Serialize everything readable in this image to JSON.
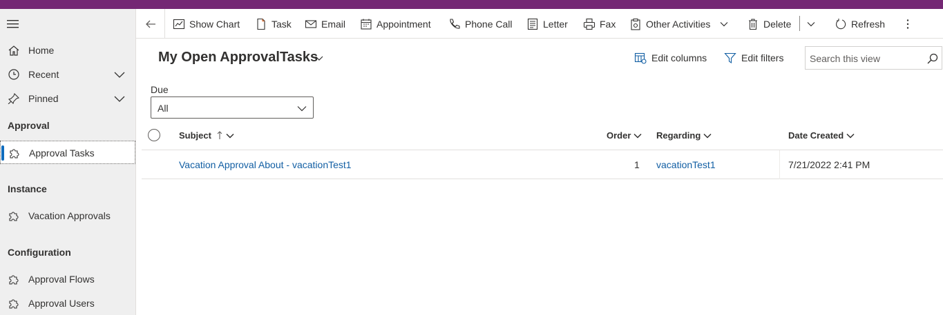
{
  "sidebar": {
    "top_items": [
      {
        "label": "Home",
        "icon": "home-icon"
      },
      {
        "label": "Recent",
        "icon": "clock-icon"
      },
      {
        "label": "Pinned",
        "icon": "pin-icon"
      }
    ],
    "groups": [
      {
        "heading": "Approval",
        "items": [
          {
            "label": "Approval Tasks",
            "icon": "puzzle-icon",
            "active": true
          }
        ]
      },
      {
        "heading": "Instance",
        "items": [
          {
            "label": "Vacation Approvals",
            "icon": "puzzle-icon"
          }
        ]
      },
      {
        "heading": "Configuration",
        "items": [
          {
            "label": "Approval Flows",
            "icon": "puzzle-icon"
          },
          {
            "label": "Approval Users",
            "icon": "puzzle-icon"
          }
        ]
      }
    ]
  },
  "commandbar": {
    "show_chart": "Show Chart",
    "task": "Task",
    "email": "Email",
    "appointment": "Appointment",
    "phone_call": "Phone Call",
    "letter": "Letter",
    "fax": "Fax",
    "other_activities": "Other Activities",
    "delete": "Delete",
    "refresh": "Refresh"
  },
  "view": {
    "title": "My Open ApprovalTasks",
    "edit_columns": "Edit columns",
    "edit_filters": "Edit filters",
    "search_placeholder": "Search this view",
    "filter_label": "Due",
    "filter_value": "All"
  },
  "grid": {
    "columns": [
      "Subject",
      "Order",
      "Regarding",
      "Date Created"
    ],
    "rows": [
      {
        "subject": "Vacation Approval About - vacationTest1",
        "order": "1",
        "regarding": "vacationTest1",
        "date_created": "7/21/2022 2:41 PM"
      }
    ]
  },
  "colors": {
    "brand": "#742774",
    "link": "#115ea3",
    "accent": "#0f6cbd"
  }
}
